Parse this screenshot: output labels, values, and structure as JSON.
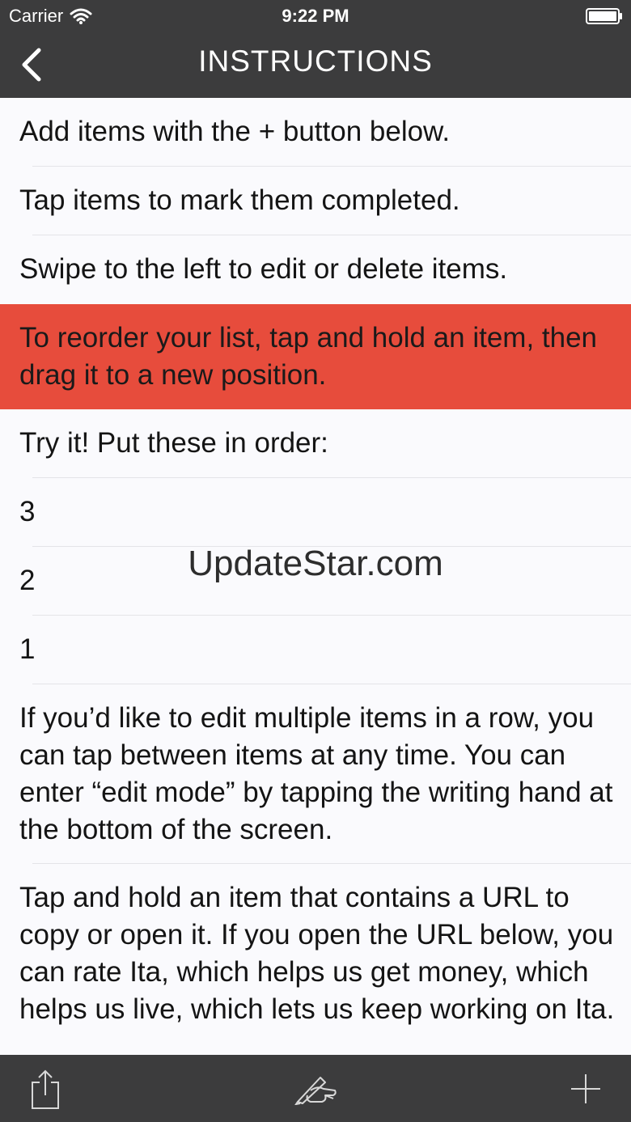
{
  "status_bar": {
    "carrier": "Carrier",
    "time": "9:22 PM"
  },
  "nav": {
    "title": "INSTRUCTIONS",
    "back_icon": "chevron-left-icon"
  },
  "rows": [
    {
      "text": "Add items with the + button below.",
      "highlighted": false
    },
    {
      "text": "Tap items to mark them completed.",
      "highlighted": false
    },
    {
      "text": "Swipe to the left to edit or delete items.",
      "highlighted": false
    },
    {
      "text": "To reorder your list, tap and hold an item, then drag it to a new position.",
      "highlighted": true
    },
    {
      "text": "Try it! Put these in order:",
      "highlighted": false
    },
    {
      "text": "3",
      "highlighted": false
    },
    {
      "text": "2",
      "highlighted": false
    },
    {
      "text": "1",
      "highlighted": false
    },
    {
      "text": "If you’d like to edit multiple items in a row, you can tap between items at any time. You can enter “edit mode” by tapping the writing hand at the bottom of the screen.",
      "highlighted": false
    },
    {
      "text": "Tap and hold an item that contains a URL to copy or open it. If you open the URL below, you can rate Ita, which helps us get money, which helps us live, which lets us keep working on Ita.",
      "highlighted": false
    }
  ],
  "watermark": "UpdateStar.com",
  "toolbar": {
    "share_icon": "share-icon",
    "edit_icon": "writing-hand-icon",
    "add_icon": "plus-icon"
  },
  "colors": {
    "bar_background": "#3c3c3d",
    "highlight": "#e74c3c",
    "list_background": "#fafafd"
  }
}
